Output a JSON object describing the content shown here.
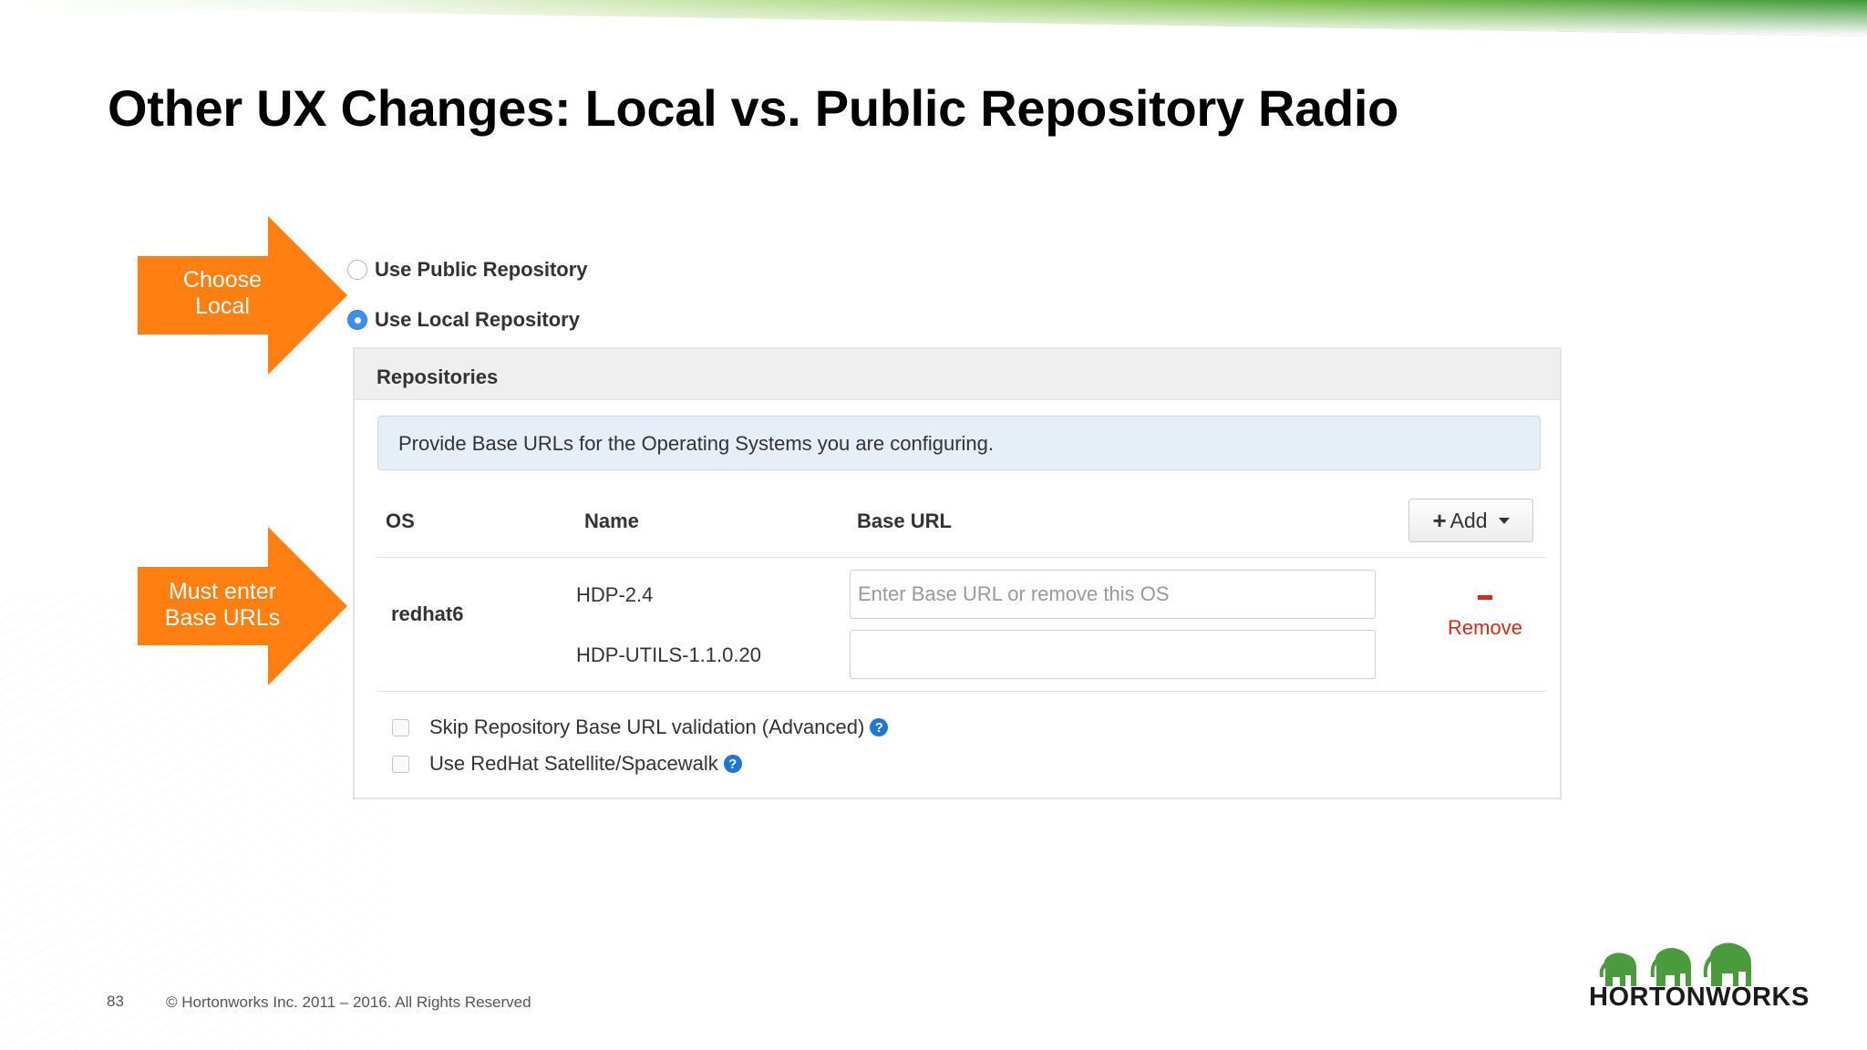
{
  "slide": {
    "title": "Other UX Changes: Local vs. Public Repository Radio",
    "page_number": "83",
    "copyright": "© Hortonworks Inc. 2011 – 2016. All Rights Reserved",
    "logo_text": "HORTONWORKS"
  },
  "callouts": [
    {
      "line1": "Choose",
      "line2": "Local",
      "color": "#ff7f11"
    },
    {
      "line1": "Must enter",
      "line2": "Base URLs",
      "color": "#ff7f11"
    }
  ],
  "repo_options": [
    {
      "label": "Use Public Repository",
      "checked": false
    },
    {
      "label": "Use Local Repository",
      "checked": true
    }
  ],
  "panel": {
    "title": "Repositories",
    "info": "Provide Base URLs for the Operating Systems you are configuring.",
    "columns": {
      "os": "OS",
      "name": "Name",
      "base_url": "Base URL"
    },
    "add_button": "Add",
    "rows": [
      {
        "os": "redhat6",
        "repos": [
          {
            "name": "HDP-2.4",
            "value": "",
            "placeholder": "Enter Base URL or remove this OS"
          },
          {
            "name": "HDP-UTILS-1.1.0.20",
            "value": "",
            "placeholder": ""
          }
        ],
        "remove_label": "Remove"
      }
    ],
    "checkboxes": [
      {
        "label": "Skip Repository Base URL validation (Advanced)",
        "checked": false
      },
      {
        "label": "Use RedHat Satellite/Spacewalk",
        "checked": false
      }
    ]
  },
  "colors": {
    "accent_orange": "#ff7f11",
    "radio_blue": "#3b8ff3",
    "remove_red": "#d62c1a",
    "brand_green": "#3f9a3a"
  }
}
